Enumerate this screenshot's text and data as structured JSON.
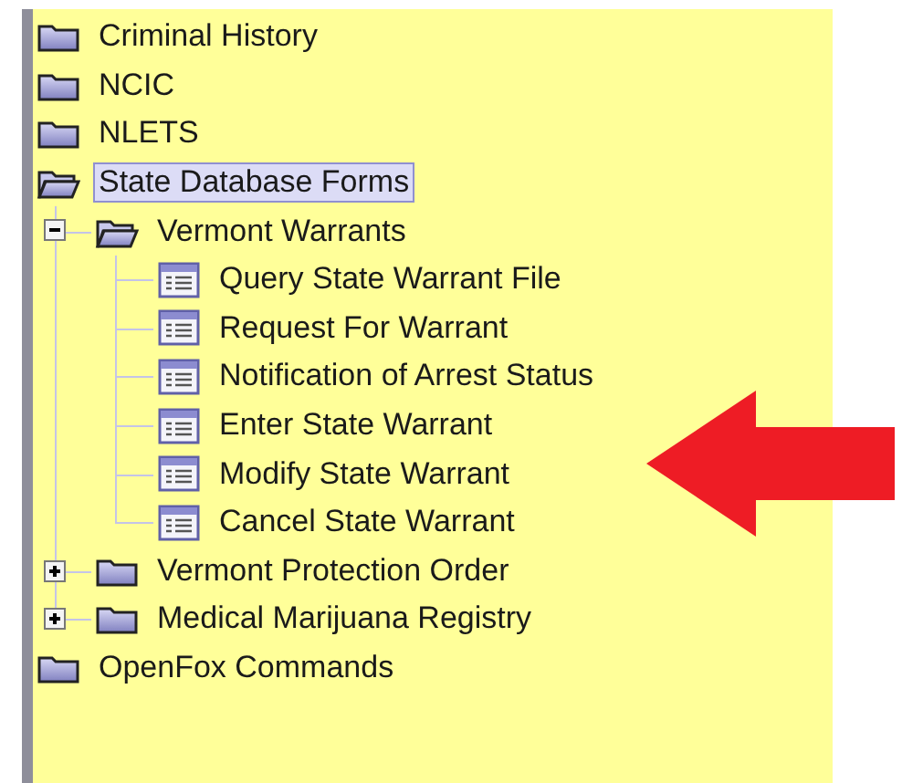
{
  "tree": [
    {
      "label": "Criminal History",
      "kind": "folder",
      "expanded": false,
      "selected": false
    },
    {
      "label": "NCIC",
      "kind": "folder",
      "expanded": false,
      "selected": false
    },
    {
      "label": "NLETS",
      "kind": "folder",
      "expanded": false,
      "selected": false
    },
    {
      "label": "State Database Forms",
      "kind": "folder",
      "expanded": true,
      "selected": true,
      "children": [
        {
          "label": "Vermont Warrants",
          "kind": "folder",
          "expanded": true,
          "selected": false,
          "children": [
            {
              "label": "Query State Warrant File",
              "kind": "form",
              "selected": false
            },
            {
              "label": "Request For Warrant",
              "kind": "form",
              "selected": false
            },
            {
              "label": "Notification of Arrest Status",
              "kind": "form",
              "selected": false
            },
            {
              "label": "Enter State Warrant",
              "kind": "form",
              "selected": false
            },
            {
              "label": "Modify State Warrant",
              "kind": "form",
              "selected": false
            },
            {
              "label": "Cancel State Warrant",
              "kind": "form",
              "selected": false
            }
          ]
        },
        {
          "label": "Vermont Protection Order",
          "kind": "folder",
          "expanded": false,
          "selected": false
        },
        {
          "label": "Medical Marijuana Registry",
          "kind": "folder",
          "expanded": false,
          "selected": false
        }
      ]
    },
    {
      "label": "OpenFox Commands",
      "kind": "folder",
      "expanded": false,
      "selected": false
    }
  ]
}
